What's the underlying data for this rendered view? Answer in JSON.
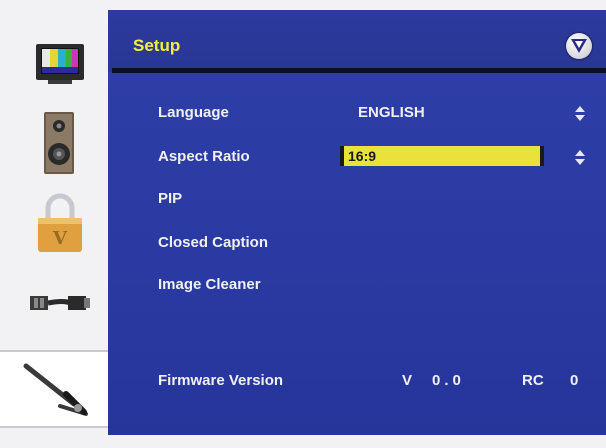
{
  "header": {
    "title": "Setup"
  },
  "sidebar": {
    "items": [
      {
        "icon": "tv-picture-icon"
      },
      {
        "icon": "speaker-icon"
      },
      {
        "icon": "padlock-icon"
      },
      {
        "icon": "cable-connector-icon"
      },
      {
        "icon": "tools-icon",
        "selected": true
      }
    ]
  },
  "menu": {
    "language": {
      "label": "Language",
      "value": "ENGLISH"
    },
    "aspect_ratio": {
      "label": "Aspect Ratio",
      "value": "16:9"
    },
    "pip": {
      "label": "PIP"
    },
    "closed_caption": {
      "label": "Closed Caption"
    },
    "image_cleaner": {
      "label": "Image Cleaner"
    }
  },
  "firmware": {
    "label": "Firmware Version",
    "v_label": "V",
    "version": "0.0",
    "rc_label": "RC",
    "rc_value": "0"
  },
  "colors": {
    "panel": "#2a3aa2",
    "title": "#f4ef3c",
    "highlight": "#e8e23a",
    "text": "#f0f0f4"
  }
}
